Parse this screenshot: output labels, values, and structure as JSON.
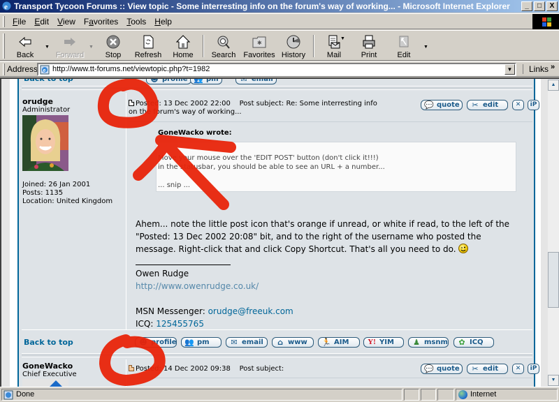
{
  "window": {
    "title": "Transport Tycoon Forums :: View topic - Some interresting info on the forum's way of working... - Microsoft Internet Explorer",
    "controls": [
      "_",
      "□",
      "X"
    ]
  },
  "menu": {
    "items": [
      {
        "label": "File",
        "accel": "F"
      },
      {
        "label": "Edit",
        "accel": "E"
      },
      {
        "label": "View",
        "accel": "V"
      },
      {
        "label": "Favorites",
        "accel": "a"
      },
      {
        "label": "Tools",
        "accel": "T"
      },
      {
        "label": "Help",
        "accel": "H"
      }
    ]
  },
  "toolbar": {
    "back": "Back",
    "forward": "Forward",
    "stop": "Stop",
    "refresh": "Refresh",
    "home": "Home",
    "search": "Search",
    "favorites": "Favorites",
    "history": "History",
    "mail": "Mail",
    "print": "Print",
    "edit": "Edit"
  },
  "address": {
    "label": "Address",
    "url": "http://www.tt-forums.net/viewtopic.php?t=1982",
    "links": "Links",
    "links_chevron": "»"
  },
  "forum": {
    "back_to_top": "Back to top",
    "post1": {
      "username": "orudge",
      "rank": "Administrator",
      "joined": "Joined: 26 Jan 2001",
      "posts": "Posts: 1135",
      "location": "Location: United Kingdom",
      "posted": "Posted: 13 Dec 2002 22:00",
      "subject_line1": "Post subject: Re: Some interresting info",
      "subject_line2": "on the forum's way of working...",
      "post_icon_state": "read",
      "buttons": {
        "quote": "quote",
        "edit": "edit",
        "delete": "✕",
        "ip": "iP"
      },
      "quote_author": "GoneWacko wrote:",
      "quote_lines": [
        "Move your mouse over the 'EDIT POST' button (don't click it!!!)",
        "in the statusbar, you should be able to see an URL + a number...",
        "",
        "... snip ..."
      ],
      "body_lines": [
        "Ahem... note the little post icon that's orange if unread, or white if read, to the left of the",
        "\"Posted: 13 Dec 2002 20:08\" bit, and to the right of the username who posted the",
        "message. Right-click that and click Copy Shortcut. That's all you need to do."
      ],
      "smiley": "wink",
      "signature": {
        "name": "Owen Rudge",
        "website": "http://www.owenrudge.co.uk/",
        "msn_label": "MSN Messenger: ",
        "msn": "orudge@freeuk.com",
        "icq_label": "ICQ: ",
        "icq": "125455765"
      },
      "profile_buttons": [
        "profile",
        "pm",
        "email",
        "www",
        "AIM",
        "YIM",
        "msnm",
        "ICQ"
      ]
    },
    "post2": {
      "username": "GoneWacko",
      "rank": "Chief Executive",
      "posted": "Posted: 14 Dec 2002 09:38",
      "subject": "Post subject:",
      "post_icon_state": "unread",
      "buttons": {
        "quote": "quote",
        "edit": "edit",
        "delete": "✕",
        "ip": "iP"
      }
    }
  },
  "statusbar": {
    "text": "Done",
    "zone": "Internet"
  },
  "colors": {
    "accent": "#006699",
    "forum_bg": "#dee3e7",
    "annotation_red": "#e8240a"
  }
}
